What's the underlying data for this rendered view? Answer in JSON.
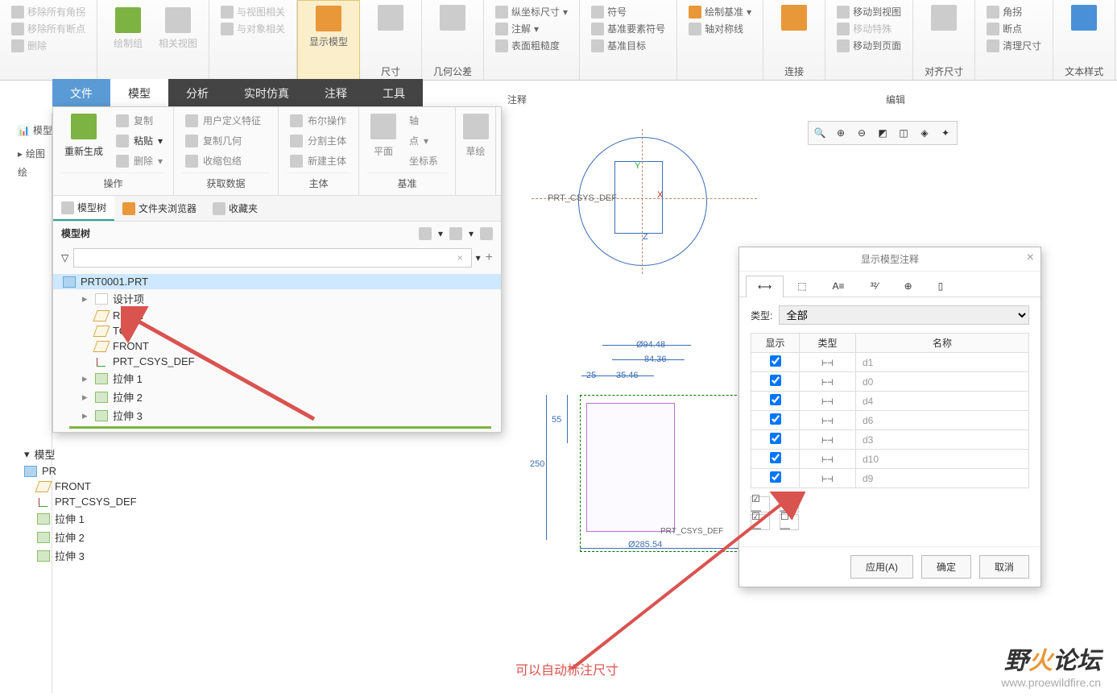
{
  "ribbon": {
    "g1": {
      "b1": "移除所有角拐",
      "b2": "移除所有断点",
      "b3": "删除"
    },
    "g2": {
      "b1": "绘制组",
      "b2": "相关视图"
    },
    "g3": {
      "b1": "与视图相关",
      "b2": "与对象相关"
    },
    "g4": {
      "big": "显示模型"
    },
    "g5": {
      "lbl": "尺寸"
    },
    "g6": {
      "lbl": "几何公差"
    },
    "g7": {
      "b1": "纵坐标尺寸",
      "b2": "注解",
      "b3": "表面粗糙度"
    },
    "g8": {
      "b1": "符号",
      "b2": "基准要素符号",
      "b3": "基准目标"
    },
    "g9": {
      "b1": "绘制基准",
      "b2": "轴对称线"
    },
    "g10": {
      "lbl": "连接"
    },
    "g11": {
      "b1": "移动到视图",
      "b2": "移动特殊",
      "b3": "移动到页面"
    },
    "g12": {
      "lbl": "对齐尺寸"
    },
    "g13": {
      "b1": "角拐",
      "b2": "断点",
      "b3": "清理尺寸"
    },
    "g14": {
      "lbl": "文本样式"
    },
    "sec_annotate": "注释",
    "sec_edit": "编辑"
  },
  "tabs": {
    "file": "文件",
    "model": "模型",
    "analysis": "分析",
    "sim": "实时仿真",
    "annotate": "注释",
    "tools": "工具"
  },
  "dd": {
    "g1": {
      "big": "重新生成",
      "b1": "复制",
      "b2": "粘贴",
      "b3": "删除",
      "lbl": "操作"
    },
    "g2": {
      "b1": "用户定义特征",
      "b2": "复制几何",
      "b3": "收缩包络",
      "lbl": "获取数据"
    },
    "g3": {
      "b1": "布尔操作",
      "b2": "分割主体",
      "b3": "新建主体",
      "lbl": "主体"
    },
    "g4": {
      "big": "平面",
      "b1": "轴",
      "b2": "点",
      "b3": "坐标系",
      "lbl": "基准"
    },
    "g5": {
      "big": "草绘"
    }
  },
  "treetabs": {
    "t1": "模型树",
    "t2": "文件夹浏览器",
    "t3": "收藏夹"
  },
  "treetitle": "模型树",
  "tree": {
    "root": "PRT0001.PRT",
    "n1": "设计项",
    "n2": "RIGHT",
    "n3": "TOP",
    "n4": "FRONT",
    "n5": "PRT_CSYS_DEF",
    "n6": "拉伸 1",
    "n7": "拉伸 2",
    "n8": "拉伸 3"
  },
  "bgtree": {
    "models": "模型",
    "draw": "绘图",
    "p": "绘",
    "pr": "PR",
    "front": "FRONT",
    "csys": "PRT_CSYS_DEF",
    "e1": "拉伸 1",
    "e2": "拉伸 2",
    "e3": "拉伸 3"
  },
  "canvas": {
    "csys": "PRT_CSYS_DEF",
    "x": "X",
    "y": "Y",
    "z": "Z",
    "d1": "Ø94.48",
    "d2": "84.36",
    "d3": "25",
    "d4": "35.46",
    "d5": "55",
    "d6": "250",
    "d7": "Ø285.54",
    "csys2": "PRT_CSYS_DEF"
  },
  "dlg": {
    "title": "显示模型注释",
    "typelabel": "类型:",
    "typeval": "全部",
    "th1": "显示",
    "th2": "类型",
    "th3": "名称",
    "rows": [
      {
        "name": "d1"
      },
      {
        "name": "d0"
      },
      {
        "name": "d4"
      },
      {
        "name": "d6"
      },
      {
        "name": "d3"
      },
      {
        "name": "d10"
      },
      {
        "name": "d9"
      }
    ],
    "apply": "应用(A)",
    "ok": "确定",
    "cancel": "取消"
  },
  "annot": "可以自动标注尺寸",
  "wm": {
    "t1a": "野",
    "t1b": "火",
    "t1c": "论坛",
    "t2": "www.proewildfire.cn"
  }
}
